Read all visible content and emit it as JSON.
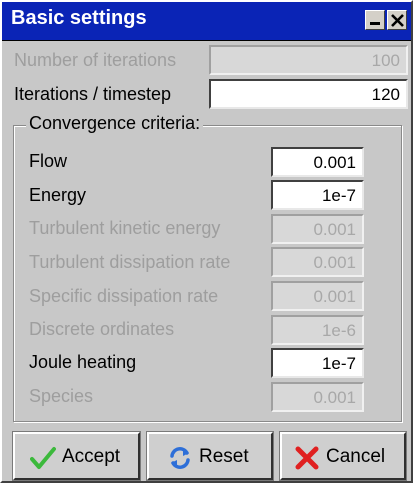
{
  "window": {
    "title": "Basic settings"
  },
  "fields": {
    "number_of_iterations": {
      "label": "Number of iterations",
      "value": "100"
    },
    "iterations_per_timestep": {
      "label": "Iterations / timestep",
      "value": "120"
    }
  },
  "convergence": {
    "title": "Convergence criteria:",
    "items": [
      {
        "label": "Flow",
        "value": "0.001"
      },
      {
        "label": "Energy",
        "value": "1e-7"
      },
      {
        "label": "Turbulent kinetic energy",
        "value": "0.001"
      },
      {
        "label": "Turbulent dissipation rate",
        "value": "0.001"
      },
      {
        "label": "Specific dissipation rate",
        "value": "0.001"
      },
      {
        "label": "Discrete ordinates",
        "value": "1e-6"
      },
      {
        "label": "Joule heating",
        "value": "1e-7"
      },
      {
        "label": "Species",
        "value": "0.001"
      }
    ]
  },
  "buttons": {
    "accept": "Accept",
    "reset": "Reset",
    "cancel": "Cancel"
  },
  "icons": {
    "minimize": "minimize-icon",
    "close": "close-icon",
    "accept": "checkmark-icon",
    "reset": "refresh-icon",
    "cancel": "cross-icon"
  },
  "colors": {
    "titlebar": "#0a24b6",
    "accept_check": "#3cb93c",
    "reset_arrows": "#2e6fd8",
    "cancel_cross": "#e02020"
  }
}
